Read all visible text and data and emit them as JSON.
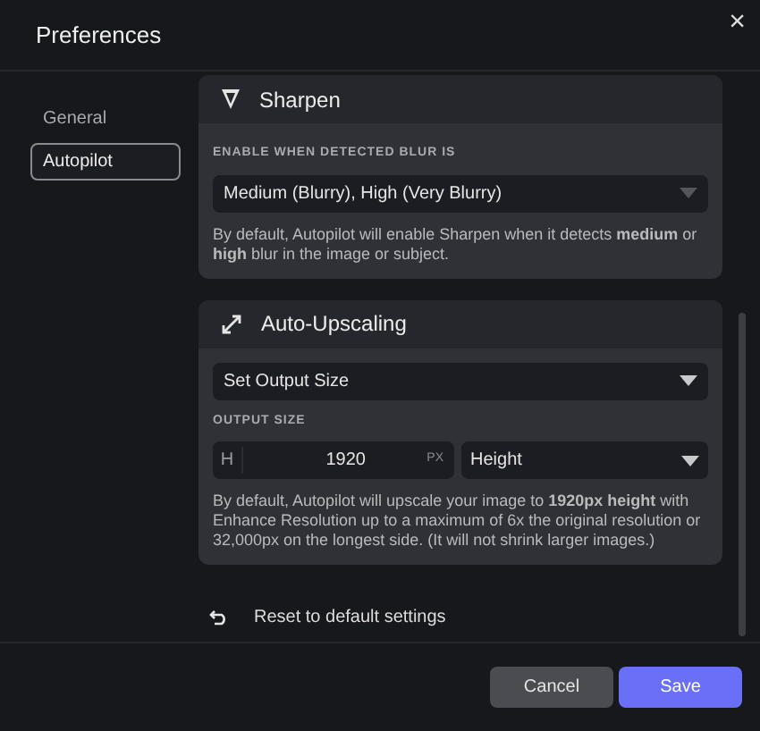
{
  "dialog": {
    "title": "Preferences",
    "close": "×"
  },
  "sidebar": {
    "items": [
      {
        "label": "General",
        "selected": false
      },
      {
        "label": "Autopilot",
        "selected": true
      }
    ]
  },
  "sections": [
    {
      "kind": "sharpen",
      "title": "Sharpen",
      "field_label": "ENABLE WHEN DETECTED BLUR IS",
      "dropdown": "Medium (Blurry), High (Very Blurry)",
      "description": "By default, Autopilot will enable Sharpen when it detects **medium** or **high** blur in the image or subject."
    },
    {
      "kind": "upscale",
      "title": "Auto-Upscaling",
      "mode_dropdown": "Set Output Size",
      "field_label": "OUTPUT SIZE",
      "size_prefix": "H",
      "size_value": "1920",
      "size_unit": "PX",
      "dimension_dropdown": "Height",
      "description": "By default, Autopilot will upscale your image to **1920px height** with Enhance Resolution up to a maximum of 6x the original resolution or 32,000px on the longest side. (It will not shrink larger images.)"
    }
  ],
  "reset": "Reset to default settings",
  "buttons": [
    {
      "kind": "secondary",
      "label": "Cancel"
    },
    {
      "kind": "primary",
      "label": "Save"
    }
  ]
}
